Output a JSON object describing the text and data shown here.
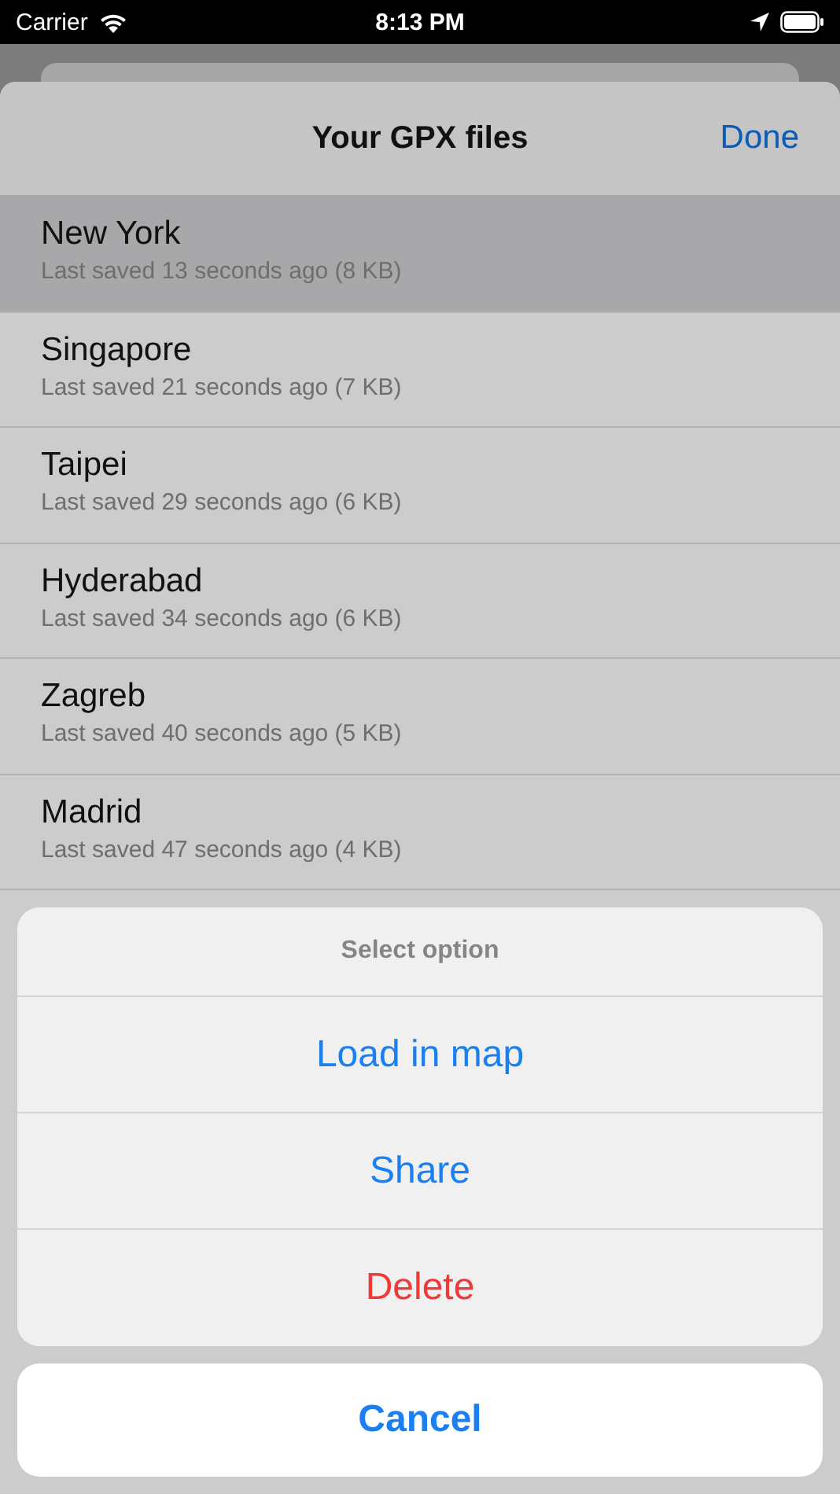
{
  "status_bar": {
    "carrier": "Carrier",
    "time": "8:13 PM"
  },
  "sheet": {
    "title": "Your GPX files",
    "done": "Done"
  },
  "files": [
    {
      "name": "New York",
      "detail": "Last saved 13 seconds ago (8 KB)",
      "selected": true
    },
    {
      "name": "Singapore",
      "detail": "Last saved 21 seconds ago (7 KB)",
      "selected": false
    },
    {
      "name": "Taipei",
      "detail": "Last saved 29 seconds ago (6 KB)",
      "selected": false
    },
    {
      "name": "Hyderabad",
      "detail": "Last saved 34 seconds ago (6 KB)",
      "selected": false
    },
    {
      "name": "Zagreb",
      "detail": "Last saved 40 seconds ago (5 KB)",
      "selected": false
    },
    {
      "name": "Madrid",
      "detail": "Last saved 47 seconds ago (4 KB)",
      "selected": false
    }
  ],
  "action_sheet": {
    "title": "Select option",
    "actions": [
      {
        "label": "Load in map",
        "kind": "default"
      },
      {
        "label": "Share",
        "kind": "default"
      },
      {
        "label": "Delete",
        "kind": "destructive"
      }
    ],
    "cancel": "Cancel"
  }
}
